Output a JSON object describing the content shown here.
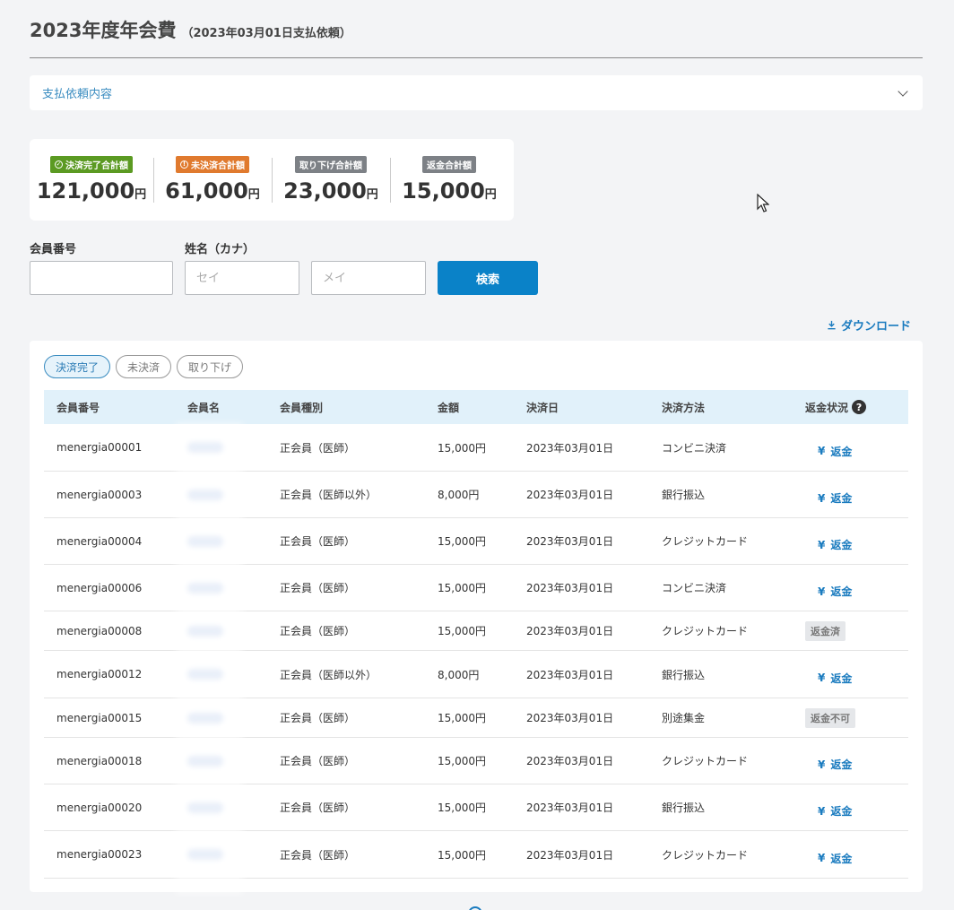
{
  "header": {
    "title": "2023年度年会費",
    "subtitle": "（2023年03月01日支払依頼）"
  },
  "accordion": {
    "label": "支払依頼内容"
  },
  "summary": [
    {
      "label": "決済完了合計額",
      "value": "121,000",
      "unit": "円",
      "color": "#5b9a22",
      "icon": "check-circle-icon"
    },
    {
      "label": "未決済合計額",
      "value": "61,000",
      "unit": "円",
      "color": "#e07a2e",
      "icon": "alert-circle-icon"
    },
    {
      "label": "取り下げ合計額",
      "value": "23,000",
      "unit": "円",
      "color": "#7d8186"
    },
    {
      "label": "返金合計額",
      "value": "15,000",
      "unit": "円",
      "color": "#7d8186"
    }
  ],
  "search": {
    "member_no_label": "会員番号",
    "name_label": "姓名（カナ）",
    "sei_placeholder": "セイ",
    "mei_placeholder": "メイ",
    "button": "検索"
  },
  "download": "ダウンロード",
  "filters": [
    "決済完了",
    "未決済",
    "取り下げ"
  ],
  "table": {
    "columns": [
      "会員番号",
      "会員名",
      "会員種別",
      "金額",
      "決済日",
      "決済方法",
      "返金状況"
    ],
    "refund_label": "返金",
    "yen_symbol": "¥",
    "rows": [
      {
        "id": "menergia00001",
        "type": "正会員（医師）",
        "amount": "15,000円",
        "date": "2023年03月01日",
        "method": "コンビニ決済",
        "status": "返金"
      },
      {
        "id": "menergia00003",
        "type": "正会員（医師以外）",
        "amount": "8,000円",
        "date": "2023年03月01日",
        "method": "銀行振込",
        "status": "返金"
      },
      {
        "id": "menergia00004",
        "type": "正会員（医師）",
        "amount": "15,000円",
        "date": "2023年03月01日",
        "method": "クレジットカード",
        "status": "返金"
      },
      {
        "id": "menergia00006",
        "type": "正会員（医師）",
        "amount": "15,000円",
        "date": "2023年03月01日",
        "method": "コンビニ決済",
        "status": "返金"
      },
      {
        "id": "menergia00008",
        "type": "正会員（医師）",
        "amount": "15,000円",
        "date": "2023年03月01日",
        "method": "クレジットカード",
        "status": "返金済"
      },
      {
        "id": "menergia00012",
        "type": "正会員（医師以外）",
        "amount": "8,000円",
        "date": "2023年03月01日",
        "method": "銀行振込",
        "status": "返金"
      },
      {
        "id": "menergia00015",
        "type": "正会員（医師）",
        "amount": "15,000円",
        "date": "2023年03月01日",
        "method": "別途集金",
        "status": "返金不可"
      },
      {
        "id": "menergia00018",
        "type": "正会員（医師）",
        "amount": "15,000円",
        "date": "2023年03月01日",
        "method": "クレジットカード",
        "status": "返金"
      },
      {
        "id": "menergia00020",
        "type": "正会員（医師）",
        "amount": "15,000円",
        "date": "2023年03月01日",
        "method": "銀行振込",
        "status": "返金"
      },
      {
        "id": "menergia00023",
        "type": "正会員（医師）",
        "amount": "15,000円",
        "date": "2023年03月01日",
        "method": "クレジットカード",
        "status": "返金"
      }
    ]
  }
}
